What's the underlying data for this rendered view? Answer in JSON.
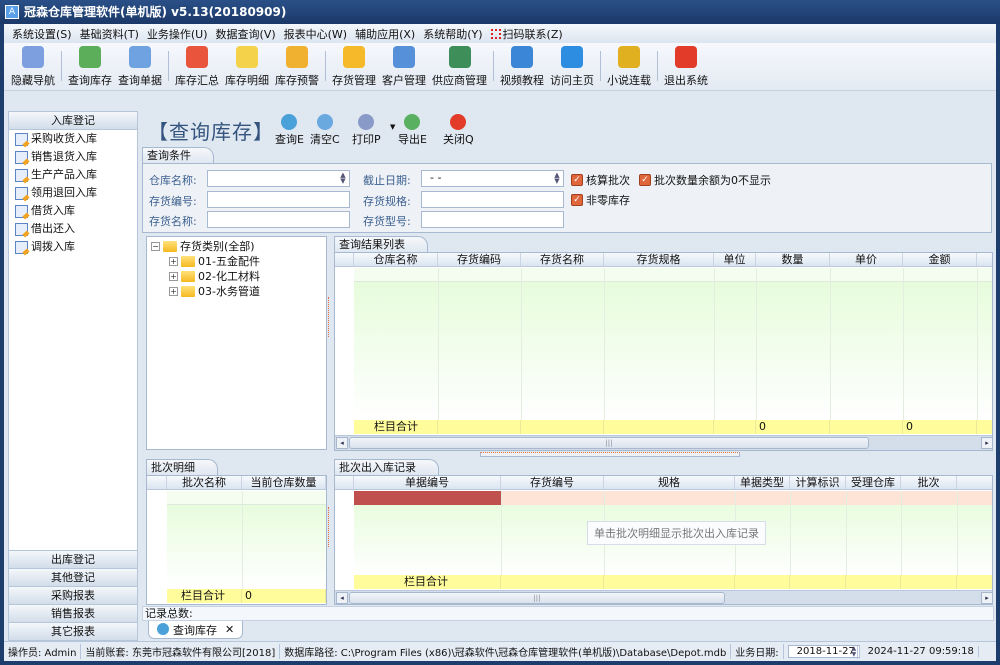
{
  "window": {
    "title": "冠森仓库管理软件(单机版) v5.13(20180909)"
  },
  "menu": [
    "系统设置(S)",
    "基础资料(T)",
    "业务操作(U)",
    "数据查询(V)",
    "报表中心(W)",
    "辅助应用(X)",
    "系统帮助(Y)",
    "扫码联系(Z)"
  ],
  "toolbar": [
    {
      "label": "隐藏导航",
      "color": "#7d9fe0"
    },
    {
      "label": "查询库存",
      "color": "#5cae5a"
    },
    {
      "label": "查询单据",
      "color": "#6fa2e0"
    },
    {
      "label": "库存汇总",
      "color": "#e8543c"
    },
    {
      "label": "库存明细",
      "color": "#f4d24a"
    },
    {
      "label": "库存预警",
      "color": "#f0b030"
    },
    {
      "label": "存货管理",
      "color": "#f5b92a"
    },
    {
      "label": "客户管理",
      "color": "#5590d8"
    },
    {
      "label": "供应商管理",
      "color": "#3e8e5a"
    },
    {
      "label": "视频教程",
      "color": "#3b86d6"
    },
    {
      "label": "访问主页",
      "color": "#2d8de0"
    },
    {
      "label": "小说连载",
      "color": "#e0b020"
    },
    {
      "label": "退出系统",
      "color": "#e23b2a"
    }
  ],
  "sidebar": {
    "header": "入库登记",
    "items": [
      "采购收货入库",
      "销售退货入库",
      "生产产品入库",
      "领用退回入库",
      "借货入库",
      "借出还入",
      "调拨入库"
    ],
    "bottom": [
      "出库登记",
      "其他登记",
      "采购报表",
      "销售报表",
      "其它报表"
    ]
  },
  "page": {
    "title": "【查询库存】",
    "buttons": [
      {
        "label": "查询E",
        "color": "#4aa0d8"
      },
      {
        "label": "清空C",
        "color": "#6aa8e0"
      },
      {
        "label": "打印P",
        "color": "#8a9ac8"
      },
      {
        "label": "导出E",
        "color": "#58b060"
      },
      {
        "label": "关闭Q",
        "color": "#e23b2a"
      }
    ]
  },
  "query": {
    "tab": "查询条件",
    "warehouse_label": "仓库名称:",
    "warehouse_value": "",
    "date_label": "截止日期:",
    "date_value": " - -",
    "code_label": "存货编号:",
    "code_value": "",
    "spec_label": "存货规格:",
    "spec_value": "",
    "name_label": "存货名称:",
    "name_value": "",
    "model_label": "存货型号:",
    "model_value": "",
    "checkboxes": [
      {
        "label": "核算批次",
        "checked": true
      },
      {
        "label": "批次数量余额为0不显示",
        "checked": true
      },
      {
        "label": "非零库存",
        "checked": true
      }
    ]
  },
  "tree": {
    "root": "存货类别(全部)",
    "children": [
      "01-五金配件",
      "02-化工材料",
      "03-水务管道"
    ]
  },
  "results": {
    "tab": "查询结果列表",
    "columns": [
      "仓库名称",
      "存货编码",
      "存货名称",
      "存货规格",
      "单位",
      "数量",
      "单价",
      "金额"
    ],
    "total_label": "栏目合计",
    "total_qty": "0",
    "total_amount": "0"
  },
  "batch": {
    "tab": "批次明细",
    "columns": [
      "批次名称",
      "当前仓库数量"
    ],
    "total_label": "栏目合计",
    "total_qty": "0"
  },
  "batch_records": {
    "tab": "批次出入库记录",
    "columns": [
      "单据编号",
      "存货编号",
      "规格",
      "单据类型",
      "计算标识",
      "受理仓库",
      "批次"
    ],
    "hint": "单击批次明细显示批次出入库记录",
    "total_label": "栏目合计"
  },
  "record_count_label": "记录总数:",
  "doc_tab": "查询库存",
  "status": {
    "operator": "操作员: Admin",
    "account": "当前账套: 东莞市冠森软件有限公司[2018]",
    "db_path": "数据库路径: C:\\Program Files (x86)\\冠森软件\\冠森仓库管理软件(单机版)\\Database\\Depot.mdb",
    "biz_date_label": "业务日期:",
    "biz_date": "2018-11-27",
    "clock": "2024-11-27 09:59:18"
  }
}
